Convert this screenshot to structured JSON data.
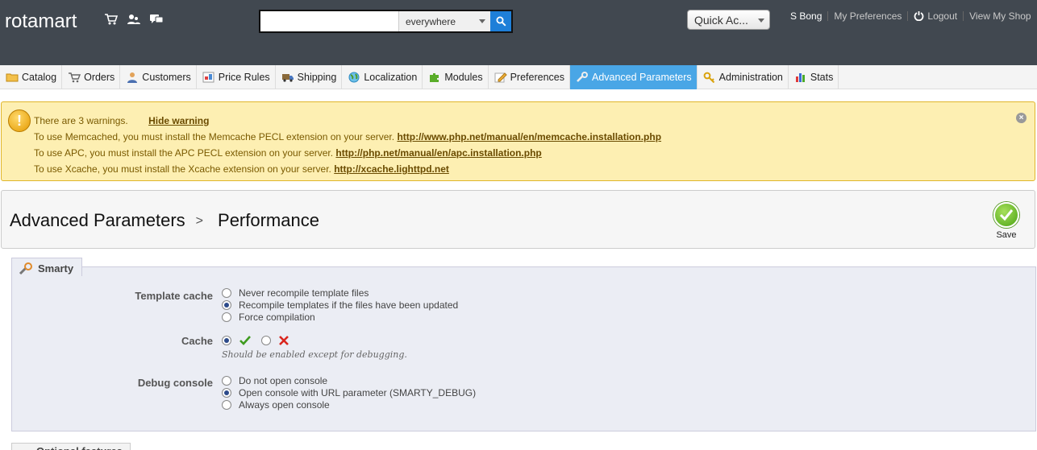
{
  "brand": "rotamart",
  "header_icons": [
    "cart-icon",
    "customers-icon",
    "messages-icon"
  ],
  "search": {
    "value": "",
    "scope": "everywhere"
  },
  "quick_access": "Quick Ac...",
  "user": {
    "name": "S Bong",
    "prefs": "My Preferences",
    "logout": "Logout",
    "view_shop": "View My Shop"
  },
  "tabs": [
    {
      "label": "Catalog",
      "icon": "folder-icon"
    },
    {
      "label": "Orders",
      "icon": "cart-icon"
    },
    {
      "label": "Customers",
      "icon": "user-icon"
    },
    {
      "label": "Price Rules",
      "icon": "price-tag-icon"
    },
    {
      "label": "Shipping",
      "icon": "truck-icon"
    },
    {
      "label": "Localization",
      "icon": "globe-icon"
    },
    {
      "label": "Modules",
      "icon": "puzzle-icon"
    },
    {
      "label": "Preferences",
      "icon": "pencil-icon"
    },
    {
      "label": "Advanced Parameters",
      "icon": "wrench-icon",
      "active": true
    },
    {
      "label": "Administration",
      "icon": "key-icon"
    },
    {
      "label": "Stats",
      "icon": "bar-chart-icon"
    }
  ],
  "warning": {
    "summary": "There are 3 warnings.",
    "hide": "Hide warning",
    "lines": [
      {
        "text": "To use Memcached, you must install the Memcache PECL extension on your server. ",
        "link": "http://www.php.net/manual/en/memcache.installation.php"
      },
      {
        "text": "To use APC, you must install the APC PECL extension on your server. ",
        "link": "http://php.net/manual/en/apc.installation.php"
      },
      {
        "text": "To use Xcache, you must install the Xcache extension on your server. ",
        "link": "http://xcache.lighttpd.net"
      }
    ]
  },
  "breadcrumb": {
    "parent": "Advanced Parameters",
    "current": "Performance"
  },
  "save_label": "Save",
  "smarty": {
    "legend": "Smarty",
    "template_cache": {
      "label": "Template cache",
      "options": [
        "Never recompile template files",
        "Recompile templates if the files have been updated",
        "Force compilation"
      ],
      "selected": 1
    },
    "cache": {
      "label": "Cache",
      "enabled": true,
      "hint": "Should be enabled except for debugging."
    },
    "debug_console": {
      "label": "Debug console",
      "options": [
        "Do not open console",
        "Open console with URL parameter (SMARTY_DEBUG)",
        "Always open console"
      ],
      "selected": 1
    }
  },
  "next_section": "Optional features"
}
